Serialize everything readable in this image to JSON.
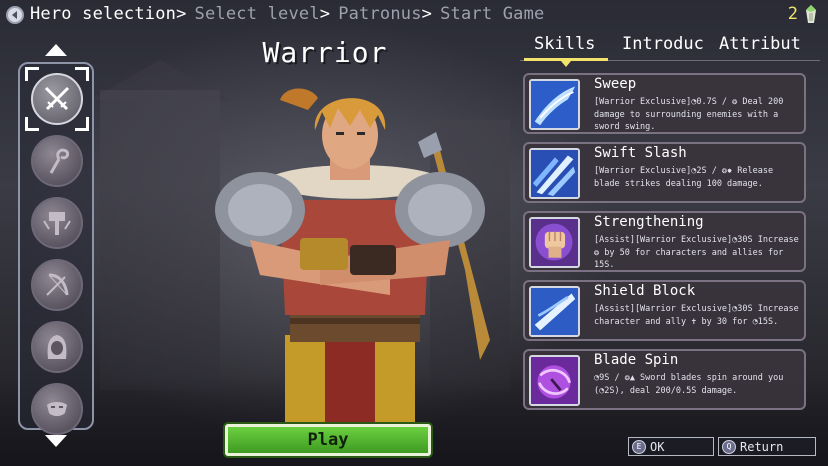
{
  "breadcrumb": {
    "steps": [
      {
        "label": "Hero selection",
        "sep": ">"
      },
      {
        "label": "Select level",
        "sep": ">"
      },
      {
        "label": "Patronus",
        "sep": ">"
      },
      {
        "label": "Start Game",
        "sep": ""
      }
    ]
  },
  "currency": {
    "amount": "2",
    "icon": "gem-icon"
  },
  "hero": {
    "name": "Warrior"
  },
  "hero_list": [
    {
      "name": "crossed-swords-icon",
      "selected": true
    },
    {
      "name": "staff-icon",
      "selected": false
    },
    {
      "name": "hammer-icon",
      "selected": false
    },
    {
      "name": "bow-icon",
      "selected": false
    },
    {
      "name": "hood-icon",
      "selected": false
    },
    {
      "name": "mask-icon",
      "selected": false
    }
  ],
  "tabs": [
    {
      "label": "Skills",
      "active": true
    },
    {
      "label": "Introduc",
      "active": false
    },
    {
      "label": "Attribut",
      "active": false
    }
  ],
  "skills": [
    {
      "name": "Sweep",
      "desc": "[Warrior Exclusive]◔0.7S / ❂ Deal 200 damage to surrounding enemies with a sword swing.",
      "icon": "sweep-icon"
    },
    {
      "name": "Swift Slash",
      "desc": "[Warrior Exclusive]◔2S / ❂✸ Release blade strikes dealing 100 damage.",
      "icon": "swift-slash-icon"
    },
    {
      "name": "Strengthening",
      "desc": "[Assist][Warrior Exclusive]◔30S Increase ❂ by 50 for characters and allies for 15S.",
      "icon": "fist-icon"
    },
    {
      "name": "Shield Block",
      "desc": "[Assist][Warrior Exclusive]◔30S Increase character and ally ✝ by 30 for ◔15S.",
      "icon": "shield-block-icon"
    },
    {
      "name": "Blade Spin",
      "desc": "◔9S / ❂▲ Sword blades spin around you (◔2S), deal 200/0.5S damage.",
      "icon": "blade-spin-icon"
    }
  ],
  "buttons": {
    "play": "Play"
  },
  "hints": {
    "ok": {
      "key": "E",
      "label": "OK"
    },
    "ret": {
      "key": "Q",
      "label": "Return"
    }
  },
  "colors": {
    "accent_yellow": "#f2e36a",
    "play_green": "#4fb22c",
    "panel_bg": "#3a343c"
  }
}
